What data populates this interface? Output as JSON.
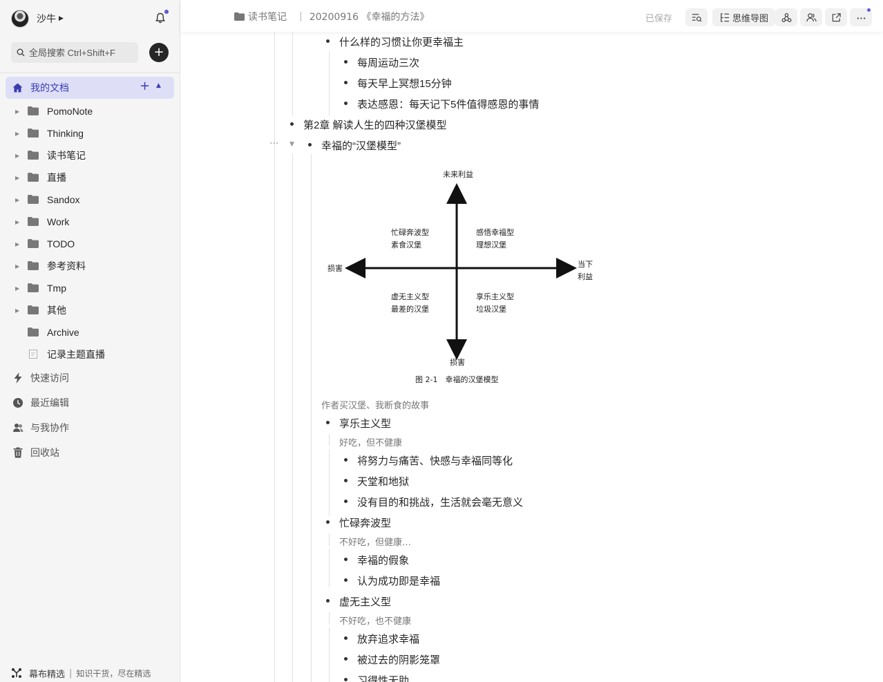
{
  "sidebar": {
    "user_name": "沙牛",
    "search_placeholder": "全局搜索 Ctrl+Shift+F",
    "my_docs_label": "我的文档",
    "tree": [
      {
        "label": "PomoNote",
        "has_children": true,
        "type": "folder"
      },
      {
        "label": "Thinking",
        "has_children": true,
        "type": "folder"
      },
      {
        "label": "读书笔记",
        "has_children": true,
        "type": "folder"
      },
      {
        "label": "直播",
        "has_children": true,
        "type": "folder"
      },
      {
        "label": "Sandox",
        "has_children": true,
        "type": "folder"
      },
      {
        "label": "Work",
        "has_children": true,
        "type": "folder"
      },
      {
        "label": "TODO",
        "has_children": true,
        "type": "folder"
      },
      {
        "label": "参考资料",
        "has_children": true,
        "type": "folder"
      },
      {
        "label": "Tmp",
        "has_children": true,
        "type": "folder"
      },
      {
        "label": "其他",
        "has_children": true,
        "type": "folder"
      },
      {
        "label": "Archive",
        "has_children": false,
        "type": "folder"
      },
      {
        "label": "记录主题直播",
        "has_children": false,
        "type": "document"
      }
    ],
    "nav": [
      {
        "label": "快速访问",
        "icon": "lightning-icon"
      },
      {
        "label": "最近编辑",
        "icon": "clock-icon"
      },
      {
        "label": "与我协作",
        "icon": "collaborate-icon"
      },
      {
        "label": "回收站",
        "icon": "trash-icon"
      }
    ],
    "footer": {
      "name": "幕布精选",
      "separator": "|",
      "slogan": "知识干货，尽在精选"
    }
  },
  "header": {
    "breadcrumb_folder": "读书笔记",
    "breadcrumb_separator": "|",
    "breadcrumb_doc": "20200916 《幸福的方法》",
    "saved_status": "已保存",
    "mindmap_label": "思维导图"
  },
  "outline": {
    "n1": "什么样的习惯让你更幸福主",
    "n1_1": "每周运动三次",
    "n1_2": "每天早上冥想15分钟",
    "n1_3": "表达感恩：每天记下5件值得感恩的事情",
    "n2": "第2章 解读人生的四种汉堡模型",
    "n2_1": "幸福的“汉堡模型”",
    "n2_1_note": "作者买汉堡、我断食的故事",
    "t1": "享乐主义型",
    "t1_note": "好吃，但不健康",
    "t1_1": "将努力与痛苦、快感与幸福同等化",
    "t1_2": "天堂和地狱",
    "t1_3": "没有目的和挑战，生活就会毫无意义",
    "t2": "忙碌奔波型",
    "t2_note": "不好吃，但健康…",
    "t2_1": "幸福的假象",
    "t2_2": "认为成功即是幸福",
    "t3": "虚无主义型",
    "t3_note": "不好吃，也不健康",
    "t3_1": "放弃追求幸福",
    "t3_2": "被过去的阴影笼罩",
    "t3_3": "习得性无助"
  },
  "figure": {
    "axis_top": "未来利益",
    "axis_bottom": "损害",
    "axis_left": "损害",
    "axis_right_1": "当下",
    "axis_right_2": "利益",
    "q_top_left_1": "忙碌奔波型",
    "q_top_left_2": "素食汉堡",
    "q_top_right_1": "感悟幸福型",
    "q_top_right_2": "理想汉堡",
    "q_bottom_left_1": "虚无主义型",
    "q_bottom_left_2": "最差的汉堡",
    "q_bottom_right_1": "享乐主义型",
    "q_bottom_right_2": "垃圾汉堡",
    "caption": "图 2-1　幸福的汉堡模型"
  },
  "colors": {
    "accent": "#5b5bd6",
    "active_bg": "#dedff7",
    "sidebar_bg": "#f5f5f5"
  }
}
